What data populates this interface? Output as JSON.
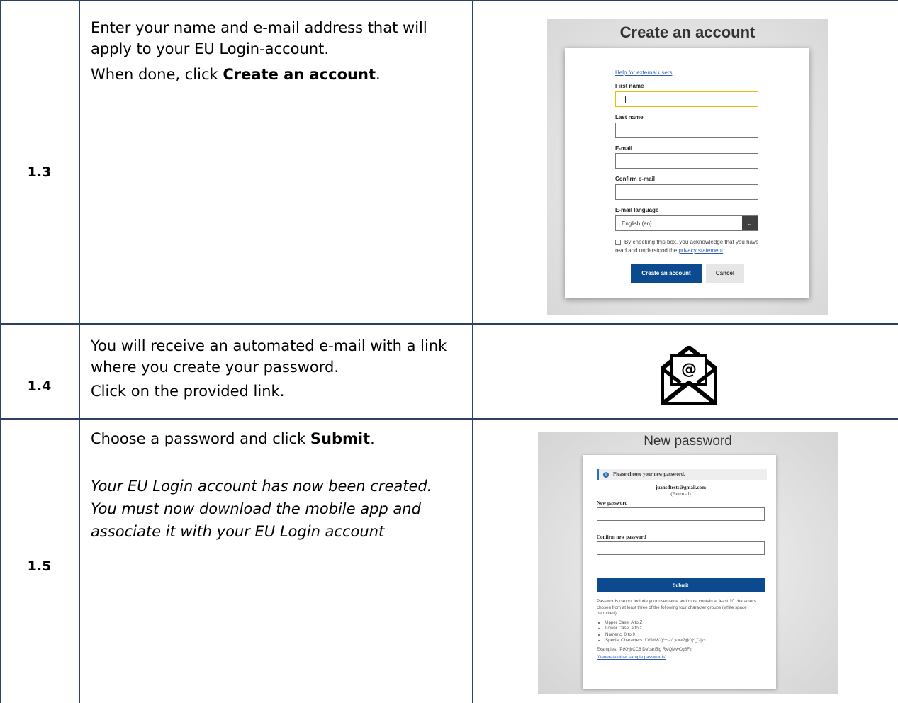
{
  "rows": [
    {
      "step": "1.3",
      "lines": [
        {
          "text": "Enter your name and e-mail address that will apply to your EU Login-account."
        },
        {
          "prefix": "When done, click ",
          "bold": "Create an account",
          "suffix": "."
        }
      ]
    },
    {
      "step": "1.4",
      "lines": [
        {
          "text": "You will receive an automated e-mail with a link where you create your password."
        },
        {
          "text": "Click on the provided link."
        }
      ]
    },
    {
      "step": "1.5",
      "lines": [
        {
          "prefix": "Choose a password and click ",
          "bold": "Submit",
          "suffix": "."
        },
        {
          "italic": "Your EU Login account has now been created. You must now download the mobile app and associate it with your EU Login account"
        }
      ]
    }
  ],
  "create_account_form": {
    "title": "Create an account",
    "help_link": "Help for external users",
    "first_name_label": "First name",
    "last_name_label": "Last name",
    "email_label": "E-mail",
    "confirm_email_label": "Confirm e-mail",
    "language_label": "E-mail language",
    "language_value": "English (en)",
    "checkbox_text": "By checking this box, you acknowledge that you have read and understood the ",
    "privacy_link": "privacy statement",
    "create_button": "Create an account",
    "cancel_button": "Cancel"
  },
  "mail_icon": {
    "icon": "envelope-at-icon",
    "glyph": "@"
  },
  "new_password_form": {
    "title": "New password",
    "info": "Please choose your new password.",
    "email": "juansdtests@gmail.com",
    "account_type": "(External)",
    "new_password_label": "New password",
    "confirm_password_label": "Confirm new password",
    "submit_button": "Submit",
    "rules_text": "Passwords cannot include your username and must contain at least 10 characters chosen from at least three of the following four character groups (white space permitted):",
    "rules": [
      "Upper Case: A to Z",
      "Lower Case: a to z",
      "Numeric: 0 to 9",
      "Special Characters: !\"#$%&'()*+,-./:;<=>?@[\\]^_`{|}~"
    ],
    "examples": "Examples: fPtKHjrCC6 DVcari5lg RVQMwCg6Fz",
    "generate_link": "[Generate other sample passwords]"
  }
}
